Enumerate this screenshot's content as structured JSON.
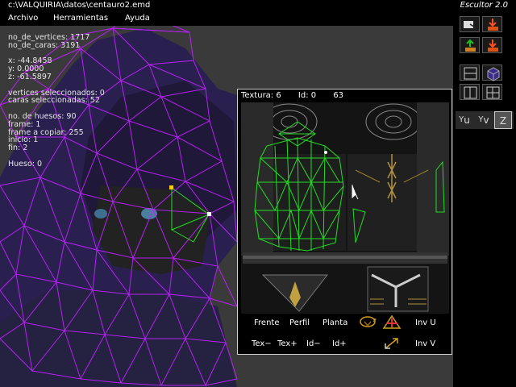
{
  "window": {
    "path": "c:\\VALQUIRIA\\datos\\centauro2.emd",
    "app_name": "Escultor 2.0"
  },
  "menu": [
    "Archivo",
    "Herramientas",
    "Ayuda"
  ],
  "info": {
    "vertices": "no_de_vertices: 1717",
    "faces": "no_de_caras: 3191",
    "x": "x: -44.8458",
    "y": "y: 0.0000",
    "z": "z: -61.5897",
    "sel_vertices": "vertices seleccionados: 0",
    "sel_faces": "caras seleccionadas: 52",
    "bones": "no. de huesos: 90",
    "frame": "frame: 1",
    "frame_copy": "frame a copiar: 255",
    "start": "inicio: 1",
    "end": "fin: 2",
    "bone": "Hueso: 0"
  },
  "texture": {
    "label": "Textura: 6",
    "id": "Id: 0",
    "count": "63"
  },
  "tex_buttons": {
    "frente": "Frente",
    "perfil": "Perfil",
    "planta": "Planta",
    "inv_u": "Inv U",
    "tex_minus": "Tex−",
    "tex_plus": "Tex+",
    "id_minus": "Id−",
    "id_plus": "Id+",
    "inv_v": "Inv V"
  },
  "axes": {
    "u": "u",
    "v": "v",
    "z": "Z"
  },
  "colors": {
    "mesh": "#c020ff",
    "uv": "#22dd22",
    "background": "#3a3a3a",
    "select": "#ffcc00"
  }
}
